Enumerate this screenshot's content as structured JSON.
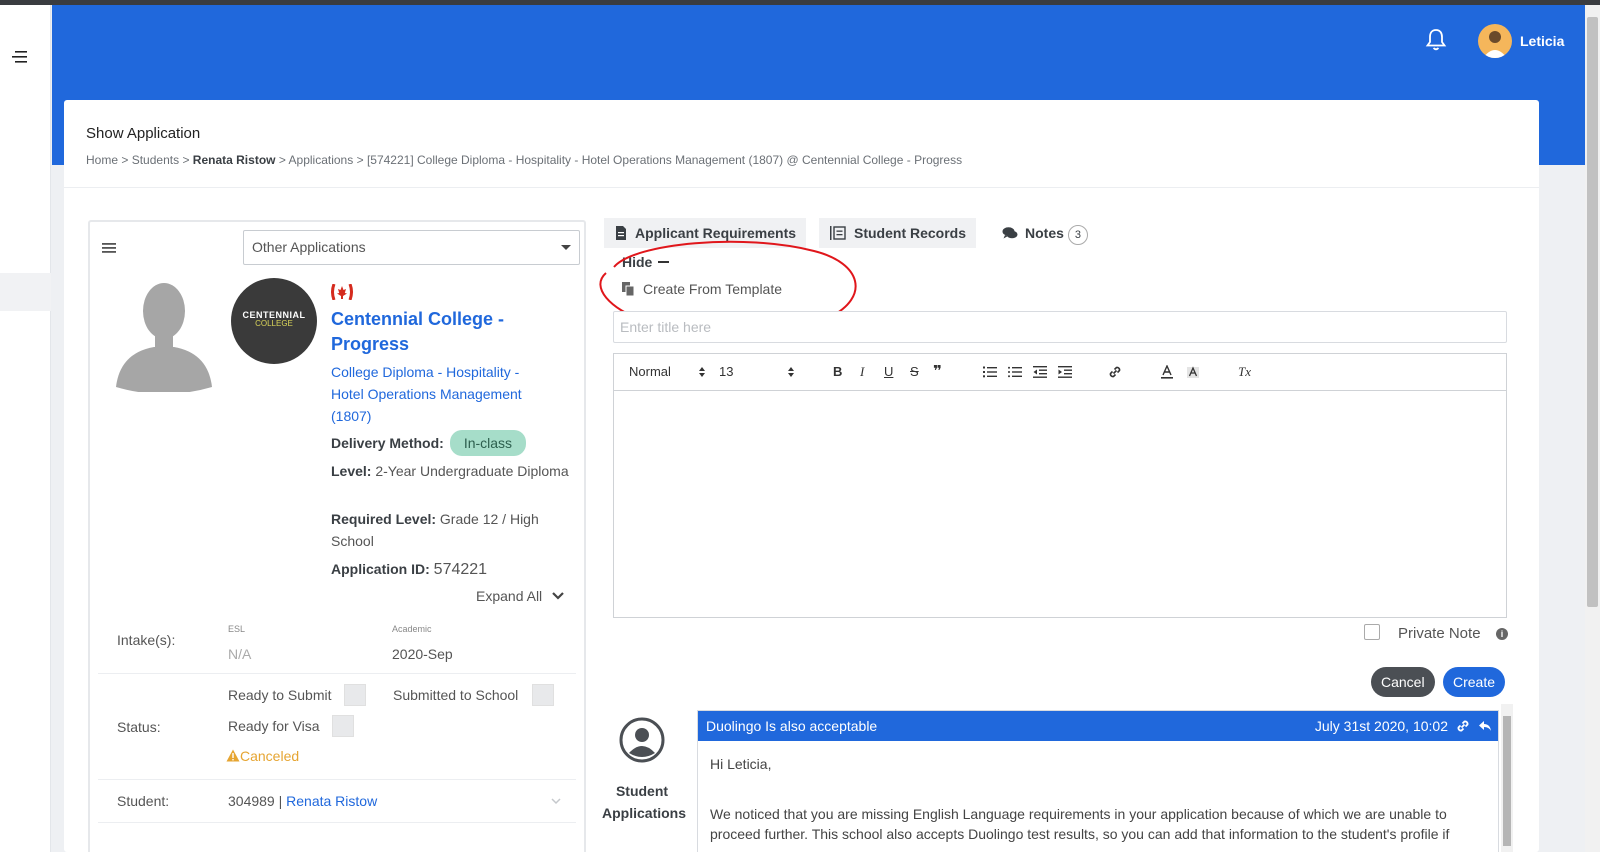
{
  "header": {
    "user_name": "Leticia"
  },
  "page": {
    "title": "Show Application",
    "breadcrumb": {
      "home": "Home",
      "students": "Students",
      "student_name": "Renata Ristow",
      "applications": "Applications",
      "current": "[574221] College Diploma - Hospitality - Hotel Operations Management (1807) @ Centennial College - Progress",
      "separator": ">"
    }
  },
  "profile": {
    "other_applications": "Other Applications",
    "logo_line1": "CENTENNIAL",
    "logo_line2": "COLLEGE",
    "college_name": "Centennial College - Progress",
    "program": "College Diploma - Hospitality - Hotel Operations Management (1807)",
    "delivery_label": "Delivery Method:",
    "delivery_value": "In-class",
    "level_label": "Level:",
    "level_value": "2-Year Undergraduate Diploma",
    "required_level_label": "Required Level:",
    "required_level_value": "Grade 12 / High School",
    "app_id_label": "Application ID:",
    "app_id_value": "574221",
    "expand_all": "Expand All",
    "intake_label": "Intake(s):",
    "esl_label": "ESL",
    "esl_value": "N/A",
    "academic_label": "Academic",
    "academic_value": "2020-Sep",
    "status_label": "Status:",
    "ready_to_submit": "Ready to Submit",
    "submitted_to_school": "Submitted to School",
    "ready_for_visa": "Ready for Visa",
    "canceled": "Canceled",
    "student_label": "Student:",
    "student_id": "304989",
    "student_sep": "|",
    "student_name": "Renata Ristow"
  },
  "tabs": [
    {
      "label": "Applicant Requirements",
      "icon": "document-icon"
    },
    {
      "label": "Student Records",
      "icon": "list-icon"
    },
    {
      "label": "Notes",
      "icon": "comments-icon",
      "count": "3"
    }
  ],
  "notes_form": {
    "hide_label": "Hide",
    "create_from_template": "Create From Template",
    "title_placeholder": "Enter title here",
    "toolbar": {
      "style": "Normal",
      "size": "13",
      "bold": "B",
      "italic": "I",
      "underline": "U",
      "strike": "S",
      "quote": "❞",
      "clear": "Tx"
    },
    "private_note": "Private Note",
    "cancel": "Cancel",
    "create": "Create"
  },
  "note": {
    "author": "Student Applications",
    "title": "Duolingo Is also acceptable",
    "date": "July 31st 2020, 10:02",
    "greeting": "Hi Leticia,",
    "body": "We noticed that you are missing English Language requirements in your application because of which we are unable to proceed further. This school also accepts Duolingo test results, so you can add that information to the student's profile if"
  },
  "colors": {
    "primary": "#2068dc",
    "pill": "#a6ddc9",
    "warning": "#e6a532",
    "annotation": "#e0161b"
  }
}
